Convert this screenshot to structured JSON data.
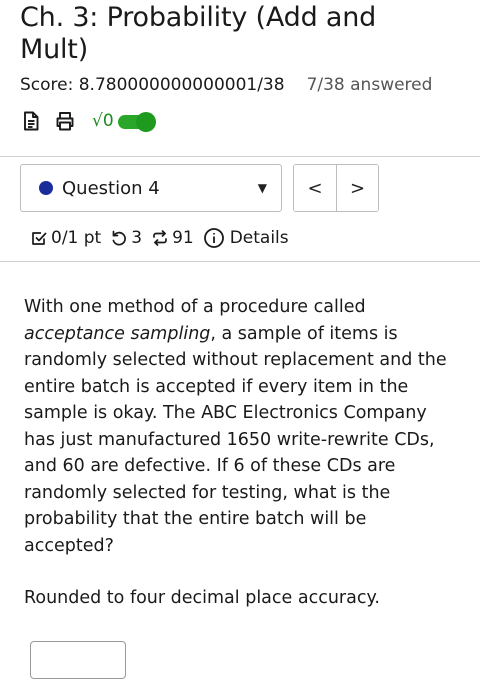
{
  "header": {
    "title": "Ch. 3: Probability (Add and Mult)",
    "score": "Score: 8.780000000000001/38",
    "answered": "7/38 answered"
  },
  "tools": {
    "icons": [
      "document-icon",
      "print-icon",
      "sqrt-icon",
      "toggle-switch"
    ],
    "math_label": "√0",
    "toggle_on": true,
    "toggle_color": "#2aa62a"
  },
  "navigation": {
    "question_select": "Question 4",
    "status_dot_color": "#1b2d9a",
    "prev_label": "<",
    "next_label": ">"
  },
  "meta": {
    "points": "0/1 pt",
    "retries": "3",
    "attempts": "91",
    "details_label": "Details"
  },
  "question": {
    "text_before": "With one method of a procedure called ",
    "text_emphasis": "acceptance sampling",
    "text_after": ", a sample of items is randomly selected without replacement and the entire batch is accepted if every item in the sample is okay. The ABC Electronics Company has just manufactured 1650 write-rewrite CDs, and 60 are defective. If 6 of these CDs are randomly selected for testing, what is the probability that the entire batch will be accepted?",
    "rounding": "Rounded to four decimal place accuracy.",
    "answer_value": ""
  }
}
